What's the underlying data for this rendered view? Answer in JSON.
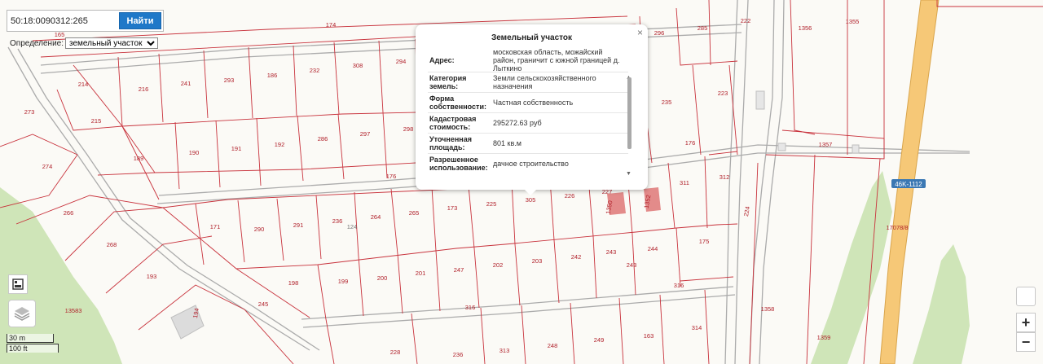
{
  "search": {
    "value": "50:18:0090312:265",
    "button_label": "Найти"
  },
  "mode": {
    "label": "Определение:",
    "selected": "земельный участок"
  },
  "popup": {
    "title": "Земельный участок",
    "close": "×",
    "rows": [
      {
        "key": "Адрес:",
        "value": "московская область, можайский район, граничит с южной границей д. Лыткино"
      },
      {
        "key": "Категория земель:",
        "value": "Земли сельскохозяйственного назначения"
      },
      {
        "key": "Форма собственности:",
        "value": "Частная собственность"
      },
      {
        "key": "Кадастровая стоимость:",
        "value": "295272.63 руб"
      },
      {
        "key": "Уточненная площадь:",
        "value": "801 кв.м"
      },
      {
        "key": "Разрешенное использование:",
        "value": "дачное строительство"
      }
    ]
  },
  "scale": {
    "metric": "30 m",
    "imperial": "100 ft"
  },
  "zoom": {
    "in": "+",
    "out": "−"
  },
  "road_label": "46K-1112",
  "parcel_labels": [
    "165",
    "174",
    "214",
    "216",
    "241",
    "293",
    "186",
    "232",
    "308",
    "294",
    "296",
    "285",
    "222",
    "1356",
    "1355",
    "273",
    "215",
    "189",
    "190",
    "191",
    "192",
    "286",
    "297",
    "298",
    "235",
    "223",
    "274",
    "176",
    "176",
    "1357",
    "311",
    "312",
    "266",
    "171",
    "290",
    "291",
    "236",
    "124",
    "264",
    "265",
    "173",
    "225",
    "305",
    "226",
    "227",
    "1350",
    "1352",
    "224",
    "268",
    "193",
    "198",
    "199",
    "200",
    "201",
    "247",
    "202",
    "203",
    "242",
    "243",
    "244",
    "175",
    "17078/8",
    "13583",
    "194",
    "245",
    "243",
    "316",
    "316",
    "1358",
    "228",
    "236",
    "313",
    "248",
    "249",
    "163",
    "314",
    "1359"
  ],
  "colors": {
    "parcel_line": "#c8323c",
    "road_line": "#ababab",
    "highway": "#f6c877",
    "green": "#cfe5b8",
    "highlight": "#e07e7e",
    "accent": "#1f78c8"
  }
}
